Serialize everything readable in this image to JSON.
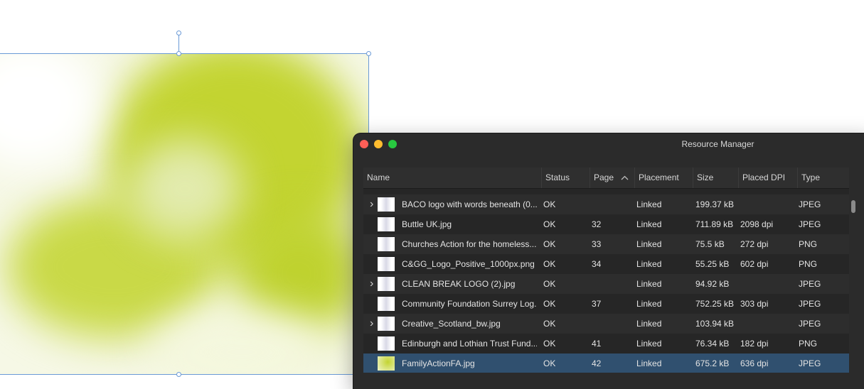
{
  "window": {
    "title": "Resource Manager"
  },
  "columns": [
    {
      "key": "name",
      "label": "Name"
    },
    {
      "key": "status",
      "label": "Status"
    },
    {
      "key": "page",
      "label": "Page"
    },
    {
      "key": "placement",
      "label": "Placement"
    },
    {
      "key": "size",
      "label": "Size"
    },
    {
      "key": "dpi",
      "label": "Placed DPI"
    },
    {
      "key": "type",
      "label": "Type"
    }
  ],
  "sort": {
    "column": "Page",
    "direction": "ascending",
    "icon": "chevron-up-icon"
  },
  "rows": [
    {
      "name": "BACO logo with words beneath (0...",
      "status": "OK",
      "page": "",
      "placement": "Linked",
      "size": "199.37 kB",
      "dpi": "",
      "type": "JPEG",
      "expandable": true,
      "thumb_icon": "baco-logo-thumbnail"
    },
    {
      "name": "Buttle UK.jpg",
      "status": "OK",
      "page": "32",
      "placement": "Linked",
      "size": "711.89 kB",
      "dpi": "2098 dpi",
      "type": "JPEG",
      "expandable": false,
      "thumb_icon": "buttle-logo-thumbnail"
    },
    {
      "name": "Churches Action for the homeless...",
      "status": "OK",
      "page": "33",
      "placement": "Linked",
      "size": "75.5 kB",
      "dpi": "272 dpi",
      "type": "PNG",
      "expandable": false,
      "thumb_icon": "churches-logo-thumbnail"
    },
    {
      "name": "C&GG_Logo_Positive_1000px.png",
      "status": "OK",
      "page": "34",
      "placement": "Linked",
      "size": "55.25 kB",
      "dpi": "602 dpi",
      "type": "PNG",
      "expandable": false,
      "thumb_icon": "cgg-logo-thumbnail"
    },
    {
      "name": "CLEAN BREAK LOGO (2).jpg",
      "status": "OK",
      "page": "",
      "placement": "Linked",
      "size": "94.92 kB",
      "dpi": "",
      "type": "JPEG",
      "expandable": true,
      "thumb_icon": "clean-break-logo-thumbnail"
    },
    {
      "name": "Community Foundation Surrey Log...",
      "status": "OK",
      "page": "37",
      "placement": "Linked",
      "size": "752.25 kB",
      "dpi": "303 dpi",
      "type": "JPEG",
      "expandable": false,
      "thumb_icon": "community-foundation-thumbnail"
    },
    {
      "name": "Creative_Scotland_bw.jpg",
      "status": "OK",
      "page": "",
      "placement": "Linked",
      "size": "103.94 kB",
      "dpi": "",
      "type": "JPEG",
      "expandable": true,
      "thumb_icon": "creative-scotland-thumbnail"
    },
    {
      "name": "Edinburgh and Lothian Trust Fund...",
      "status": "OK",
      "page": "41",
      "placement": "Linked",
      "size": "76.34 kB",
      "dpi": "182 dpi",
      "type": "PNG",
      "expandable": false,
      "thumb_icon": "edinburgh-trust-thumbnail"
    },
    {
      "name": "FamilyActionFA.jpg",
      "status": "OK",
      "page": "42",
      "placement": "Linked",
      "size": "675.2 kB",
      "dpi": "636 dpi",
      "type": "JPEG",
      "expandable": false,
      "selected": true,
      "thumb_icon": "family-action-thumbnail"
    }
  ],
  "colors": {
    "selection_outline": "#6a9ad6",
    "selected_row": "#30506f",
    "image_green": "#bfd22f"
  }
}
